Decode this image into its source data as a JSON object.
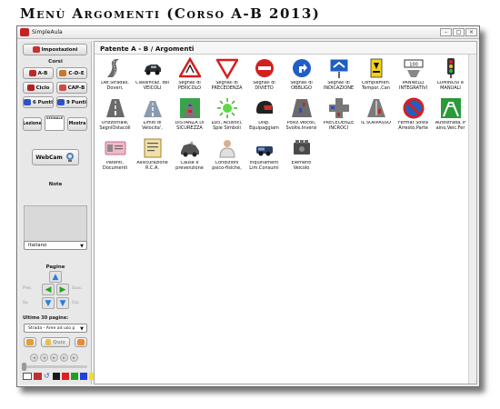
{
  "heading": "Menù Argomenti (Corso A-B 2013)",
  "window": {
    "title": "SimpleAula",
    "min": "–",
    "max": "□",
    "close": "×"
  },
  "sidebar": {
    "impostazioni": "Impostazioni",
    "corsi_label": "Corsi",
    "corsi": [
      "A-B",
      "C-D-E",
      "Ciclo",
      "CAP-B",
      "6 Punti",
      "9 Punti"
    ],
    "lezione": "Lezione",
    "segnale": "SEGNALE",
    "mostra": "Mostra",
    "webcam": "WebCam",
    "note_label": "Note",
    "language": "Italiano",
    "pagine_label": "Pagine",
    "nav": {
      "prev": "Prec.",
      "next": "Succ.",
      "up": "Su",
      "down": "Giù"
    },
    "ultime_label": "Ultime 30 pagine:",
    "ultime_value": "Strada - Aree ad uso p",
    "quiz": "Quiz"
  },
  "main": {
    "header": "Patente A - B / Argomenti",
    "items": [
      {
        "caption": "Def.Stradali, Doveri,",
        "icon": "road-icon"
      },
      {
        "caption": "Classificaz. dei VEICOLI",
        "icon": "vehicle-icon"
      },
      {
        "caption": "Segnali di PERICOLO",
        "icon": "danger-sign-icon"
      },
      {
        "caption": "Segnali di PRECEDENZA",
        "icon": "yield-sign-icon"
      },
      {
        "caption": "Segnali di DIVIETO",
        "icon": "prohibition-sign-icon"
      },
      {
        "caption": "Segnali di OBBLIGO",
        "icon": "mandatory-sign-icon"
      },
      {
        "caption": "Segnali di INDICAZIONE",
        "icon": "direction-sign-icon"
      },
      {
        "caption": "Complemen. Tempor.,Can",
        "icon": "roadworks-icon"
      },
      {
        "caption": "PANNELLI INTEGRATIVI",
        "icon": "panel-icon"
      },
      {
        "caption": "LUMINOSI e MANUALI",
        "icon": "traffic-light-icon"
      },
      {
        "caption": "Orizzontale, SegniOstacoli",
        "icon": "road-markings-icon"
      },
      {
        "caption": "Limiti di Velocita',",
        "icon": "speed-limit-icon"
      },
      {
        "caption": "DISTANZA DI SICUREZZA",
        "icon": "distance-icon"
      },
      {
        "caption": "Luci, Acustici, Spie Simboli",
        "icon": "lights-icon"
      },
      {
        "caption": "Disp. Equipaggiam",
        "icon": "helmet-icon"
      },
      {
        "caption": "Posiz.Veicoli, Svolte,Inversi",
        "icon": "lanes-icon"
      },
      {
        "caption": "PRECEDENZE INCROCI",
        "icon": "intersection-icon"
      },
      {
        "caption": "IL SORPASSO",
        "icon": "overtaking-icon"
      },
      {
        "caption": "Fermat Sosta Arresto,Parte",
        "icon": "no-parking-icon"
      },
      {
        "caption": "Autostrada,Tr aino,Veic.Fer",
        "icon": "motorway-icon"
      },
      {
        "caption": "Patenti, Documenti",
        "icon": "license-icon"
      },
      {
        "caption": "Assicurazione R.C.A.",
        "icon": "insurance-icon"
      },
      {
        "caption": "Cause e prevenzione",
        "icon": "crash-icon"
      },
      {
        "caption": "Condizioni psico-fisiche,",
        "icon": "person-icon"
      },
      {
        "caption": "Inquinament Lim.Consumi",
        "icon": "pollution-icon"
      },
      {
        "caption": "Elementi Veicolo",
        "icon": "engine-icon"
      }
    ]
  }
}
